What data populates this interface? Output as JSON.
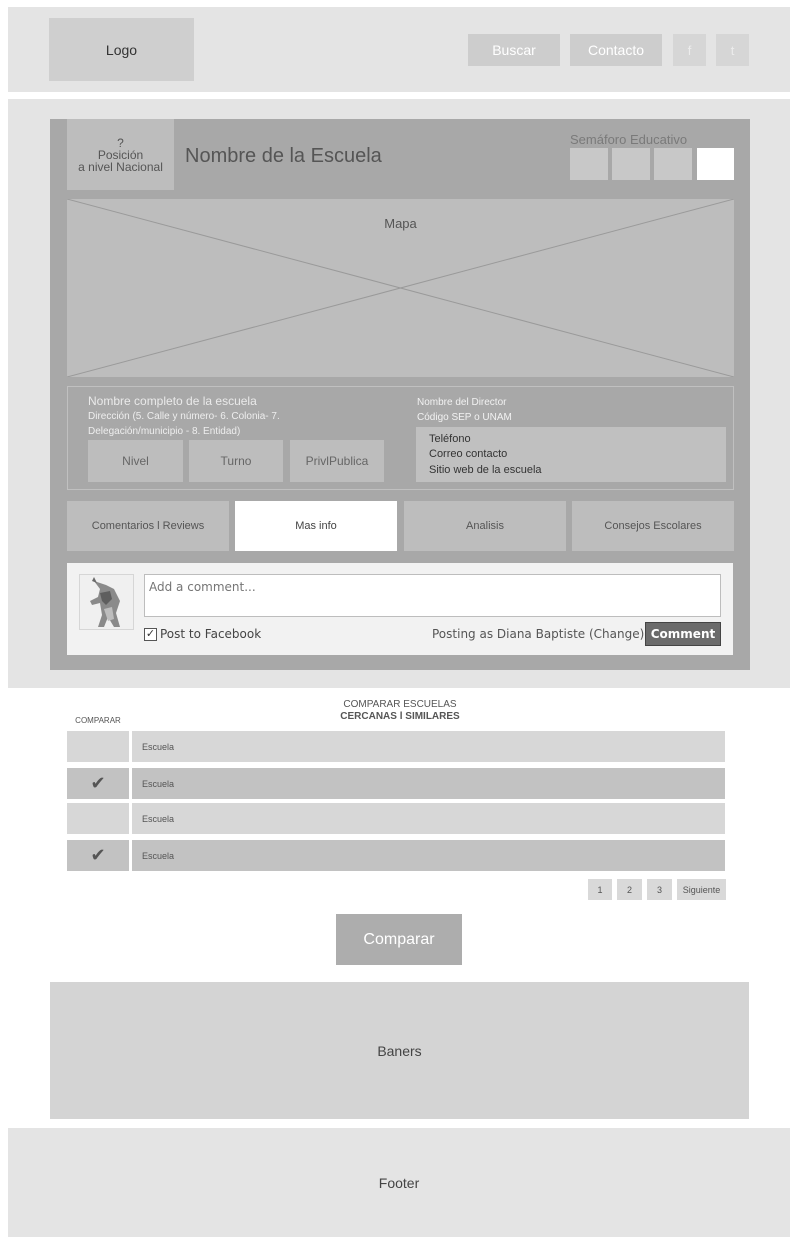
{
  "header": {
    "logo": "Logo",
    "buscar": "Buscar",
    "contacto": "Contacto",
    "facebook": "f",
    "twitter": "t"
  },
  "school": {
    "rank_q": "?",
    "rank_line1": "Posición",
    "rank_line2": "a nivel Nacional",
    "name": "Nombre de la Escuela",
    "semaforo_label": "Semáforo Educativo",
    "map_label": "Mapa"
  },
  "info": {
    "full_name": "Nombre completo de la escuela",
    "address": "Dirección (5. Calle y número- 6. Colonia- 7. Delegación/municipio - 8. Entidad)",
    "nivel": "Nivel",
    "turno": "Turno",
    "priv_publica": "PrivlPublica",
    "director": "Nombre del Director",
    "codigo": "Código SEP o UNAM",
    "telefono": "Teléfono",
    "correo": "Correo contacto",
    "sitio": "Sitio web de la escuela"
  },
  "tabs": [
    {
      "label": "Comentarios l Reviews"
    },
    {
      "label": "Mas info"
    },
    {
      "label": "Analisis"
    },
    {
      "label": "Consejos Escolares"
    }
  ],
  "comments": {
    "placeholder": "Add a comment...",
    "post_to_facebook": "Post to Facebook",
    "posting_as": "Posting as Diana Baptiste (Change)",
    "button": "Comment"
  },
  "compare": {
    "title": "COMPARAR ESCUELAS",
    "subtitle": "CERCANAS l SIMILARES",
    "column": "COMPARAR",
    "rows": [
      {
        "name": "Escuela",
        "checked": false
      },
      {
        "name": "Escuela",
        "checked": true
      },
      {
        "name": "Escuela",
        "checked": false
      },
      {
        "name": "Escuela",
        "checked": true
      }
    ],
    "check_glyph": "✔",
    "pages": [
      "1",
      "2",
      "3"
    ],
    "next": "Siguiente",
    "button": "Comparar"
  },
  "banners": "Baners",
  "footer": "Footer"
}
